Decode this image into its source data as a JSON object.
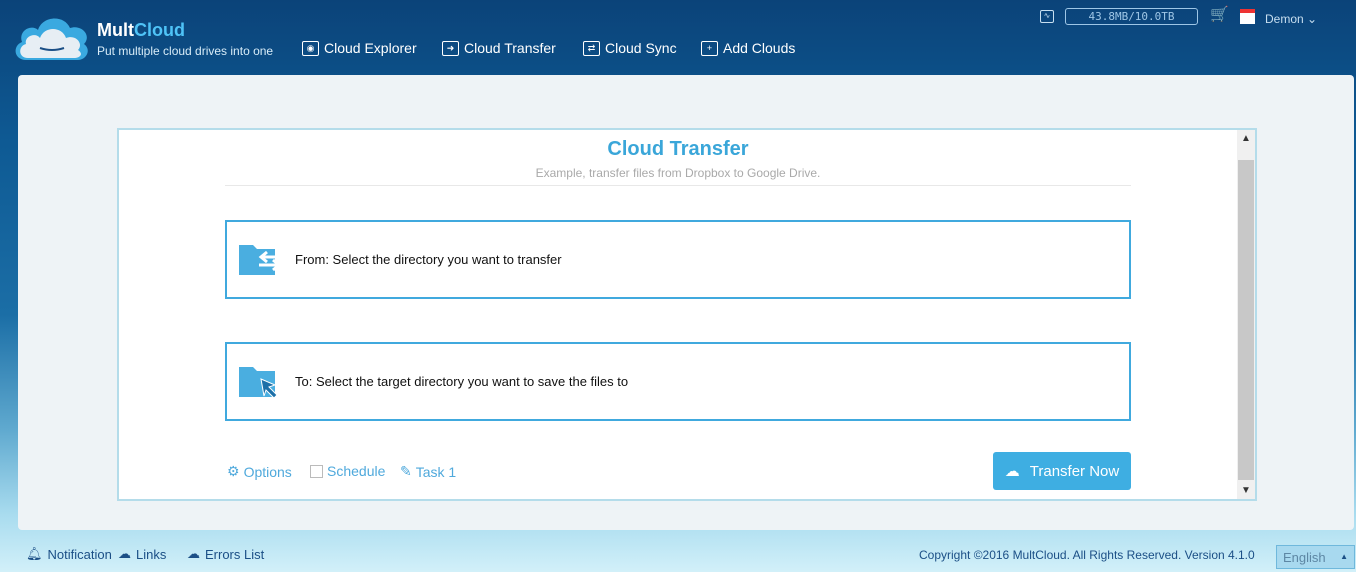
{
  "header": {
    "brand_a": "Mult",
    "brand_b": "Cloud",
    "tagline": "Put multiple cloud drives into one",
    "nav": [
      "Cloud Explorer",
      "Cloud Transfer",
      "Cloud Sync",
      "Add Clouds"
    ],
    "quota": "43.8MB/10.0TB",
    "user": "Demon"
  },
  "panel": {
    "title": "Cloud Transfer",
    "subtitle": "Example, transfer files from Dropbox to Google Drive.",
    "from": "From: Select the directory you want to transfer",
    "to": "To: Select the target directory you want to save the files to",
    "options": "Options",
    "schedule": "Schedule",
    "task": "Task 1",
    "transfer_now": "Transfer Now"
  },
  "footer": {
    "notification": "Notification",
    "links": "Links",
    "errors": "Errors List",
    "copyright": "Copyright ©2016 MultCloud. All Rights Reserved. Version 4.1.0",
    "language": "English"
  },
  "colors": {
    "accent": "#3eaee2"
  }
}
